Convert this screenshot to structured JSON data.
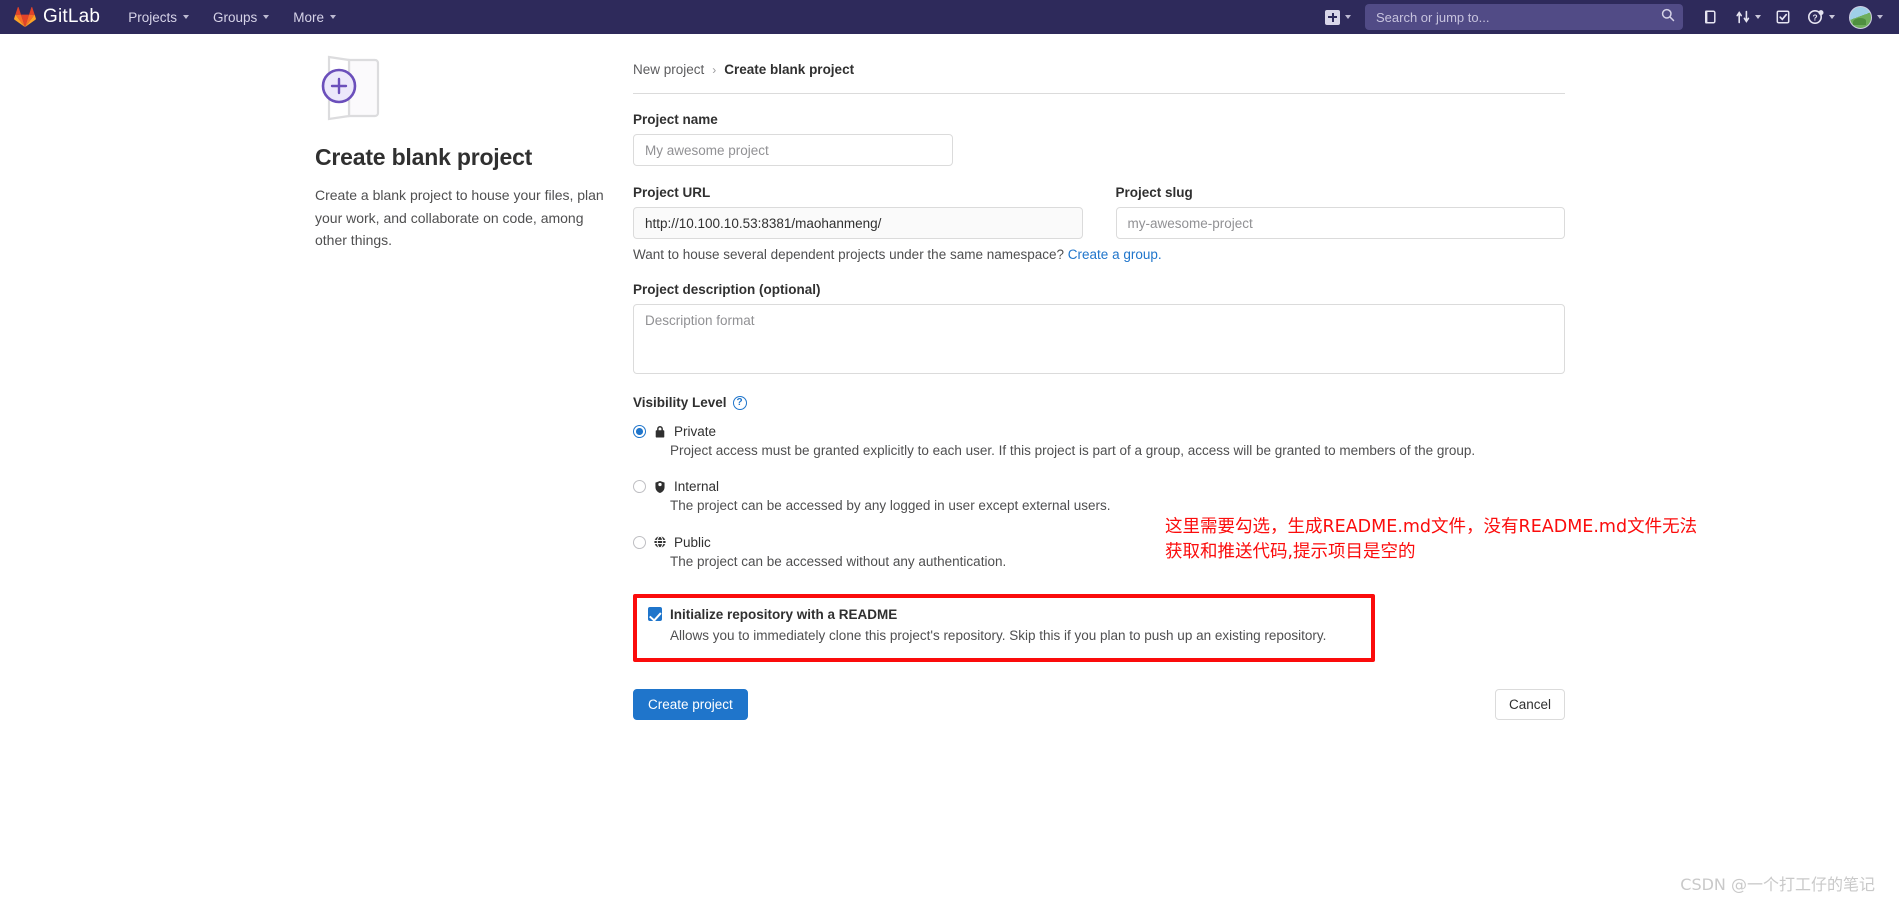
{
  "navbar": {
    "brand": "GitLab",
    "brand_logo_icon": "gitlab-fox-logo-icon",
    "items": [
      {
        "label": "Projects",
        "icon": "chevron-down-icon"
      },
      {
        "label": "Groups",
        "icon": "chevron-down-icon"
      },
      {
        "label": "More",
        "icon": "chevron-down-icon"
      }
    ],
    "create_new": {
      "icon": "plus-square-icon",
      "caret_icon": "chevron-down-icon"
    },
    "search": {
      "placeholder": "Search or jump to...",
      "value": "",
      "icon": "search-icon"
    },
    "right_icons": [
      {
        "name": "issues-icon",
        "caret": false
      },
      {
        "name": "merge-requests-icon",
        "caret": true
      },
      {
        "name": "todos-icon",
        "caret": false
      },
      {
        "name": "help-icon",
        "caret": true
      },
      {
        "name": "user-avatar",
        "caret": true
      }
    ],
    "colors": {
      "background": "#2e2a5b",
      "search_background": "#514b86",
      "text": "#d6d3e8"
    }
  },
  "promo": {
    "illustration_icon": "blank-project-folder-plus-icon",
    "title": "Create blank project",
    "description": "Create a blank project to house your files, plan your work, and collaborate on code, among other things."
  },
  "breadcrumb": {
    "parent": "New project",
    "separator": "›",
    "current": "Create blank project"
  },
  "form": {
    "project_name": {
      "label": "Project name",
      "placeholder": "My awesome project",
      "value": ""
    },
    "project_url": {
      "label": "Project URL",
      "value": "http://10.100.10.53:8381/maohanmeng/"
    },
    "project_slug": {
      "label": "Project slug",
      "placeholder": "my-awesome-project",
      "value": ""
    },
    "namespace_hint": {
      "text": "Want to house several dependent projects under the same namespace?",
      "link": "Create a group."
    },
    "project_description": {
      "label": "Project description (optional)",
      "placeholder": "Description format",
      "value": ""
    },
    "visibility": {
      "label": "Visibility Level",
      "help_icon": "question-circle-icon",
      "selected": "private",
      "options": [
        {
          "id": "private",
          "icon": "lock-icon",
          "name": "Private",
          "description": "Project access must be granted explicitly to each user. If this project is part of a group, access will be granted to members of the group.",
          "checked": true
        },
        {
          "id": "internal",
          "icon": "shield-icon",
          "name": "Internal",
          "description": "The project can be accessed by any logged in user except external users.",
          "checked": false
        },
        {
          "id": "public",
          "icon": "globe-icon",
          "name": "Public",
          "description": "The project can be accessed without any authentication.",
          "checked": false
        }
      ]
    },
    "readme": {
      "checked": true,
      "title": "Initialize repository with a README",
      "description": "Allows you to immediately clone this project's repository. Skip this if you plan to push up an existing repository.",
      "highlight_color": "#fb0c0c"
    },
    "submit_label": "Create project",
    "cancel_label": "Cancel"
  },
  "annotation": {
    "text": "这里需要勾选，生成README.md文件，没有README.md文件无法\n获取和推送代码,提示项目是空的",
    "color": "#fb0c0c"
  },
  "watermark": {
    "text": "CSDN @一个打工仔的笔记"
  }
}
